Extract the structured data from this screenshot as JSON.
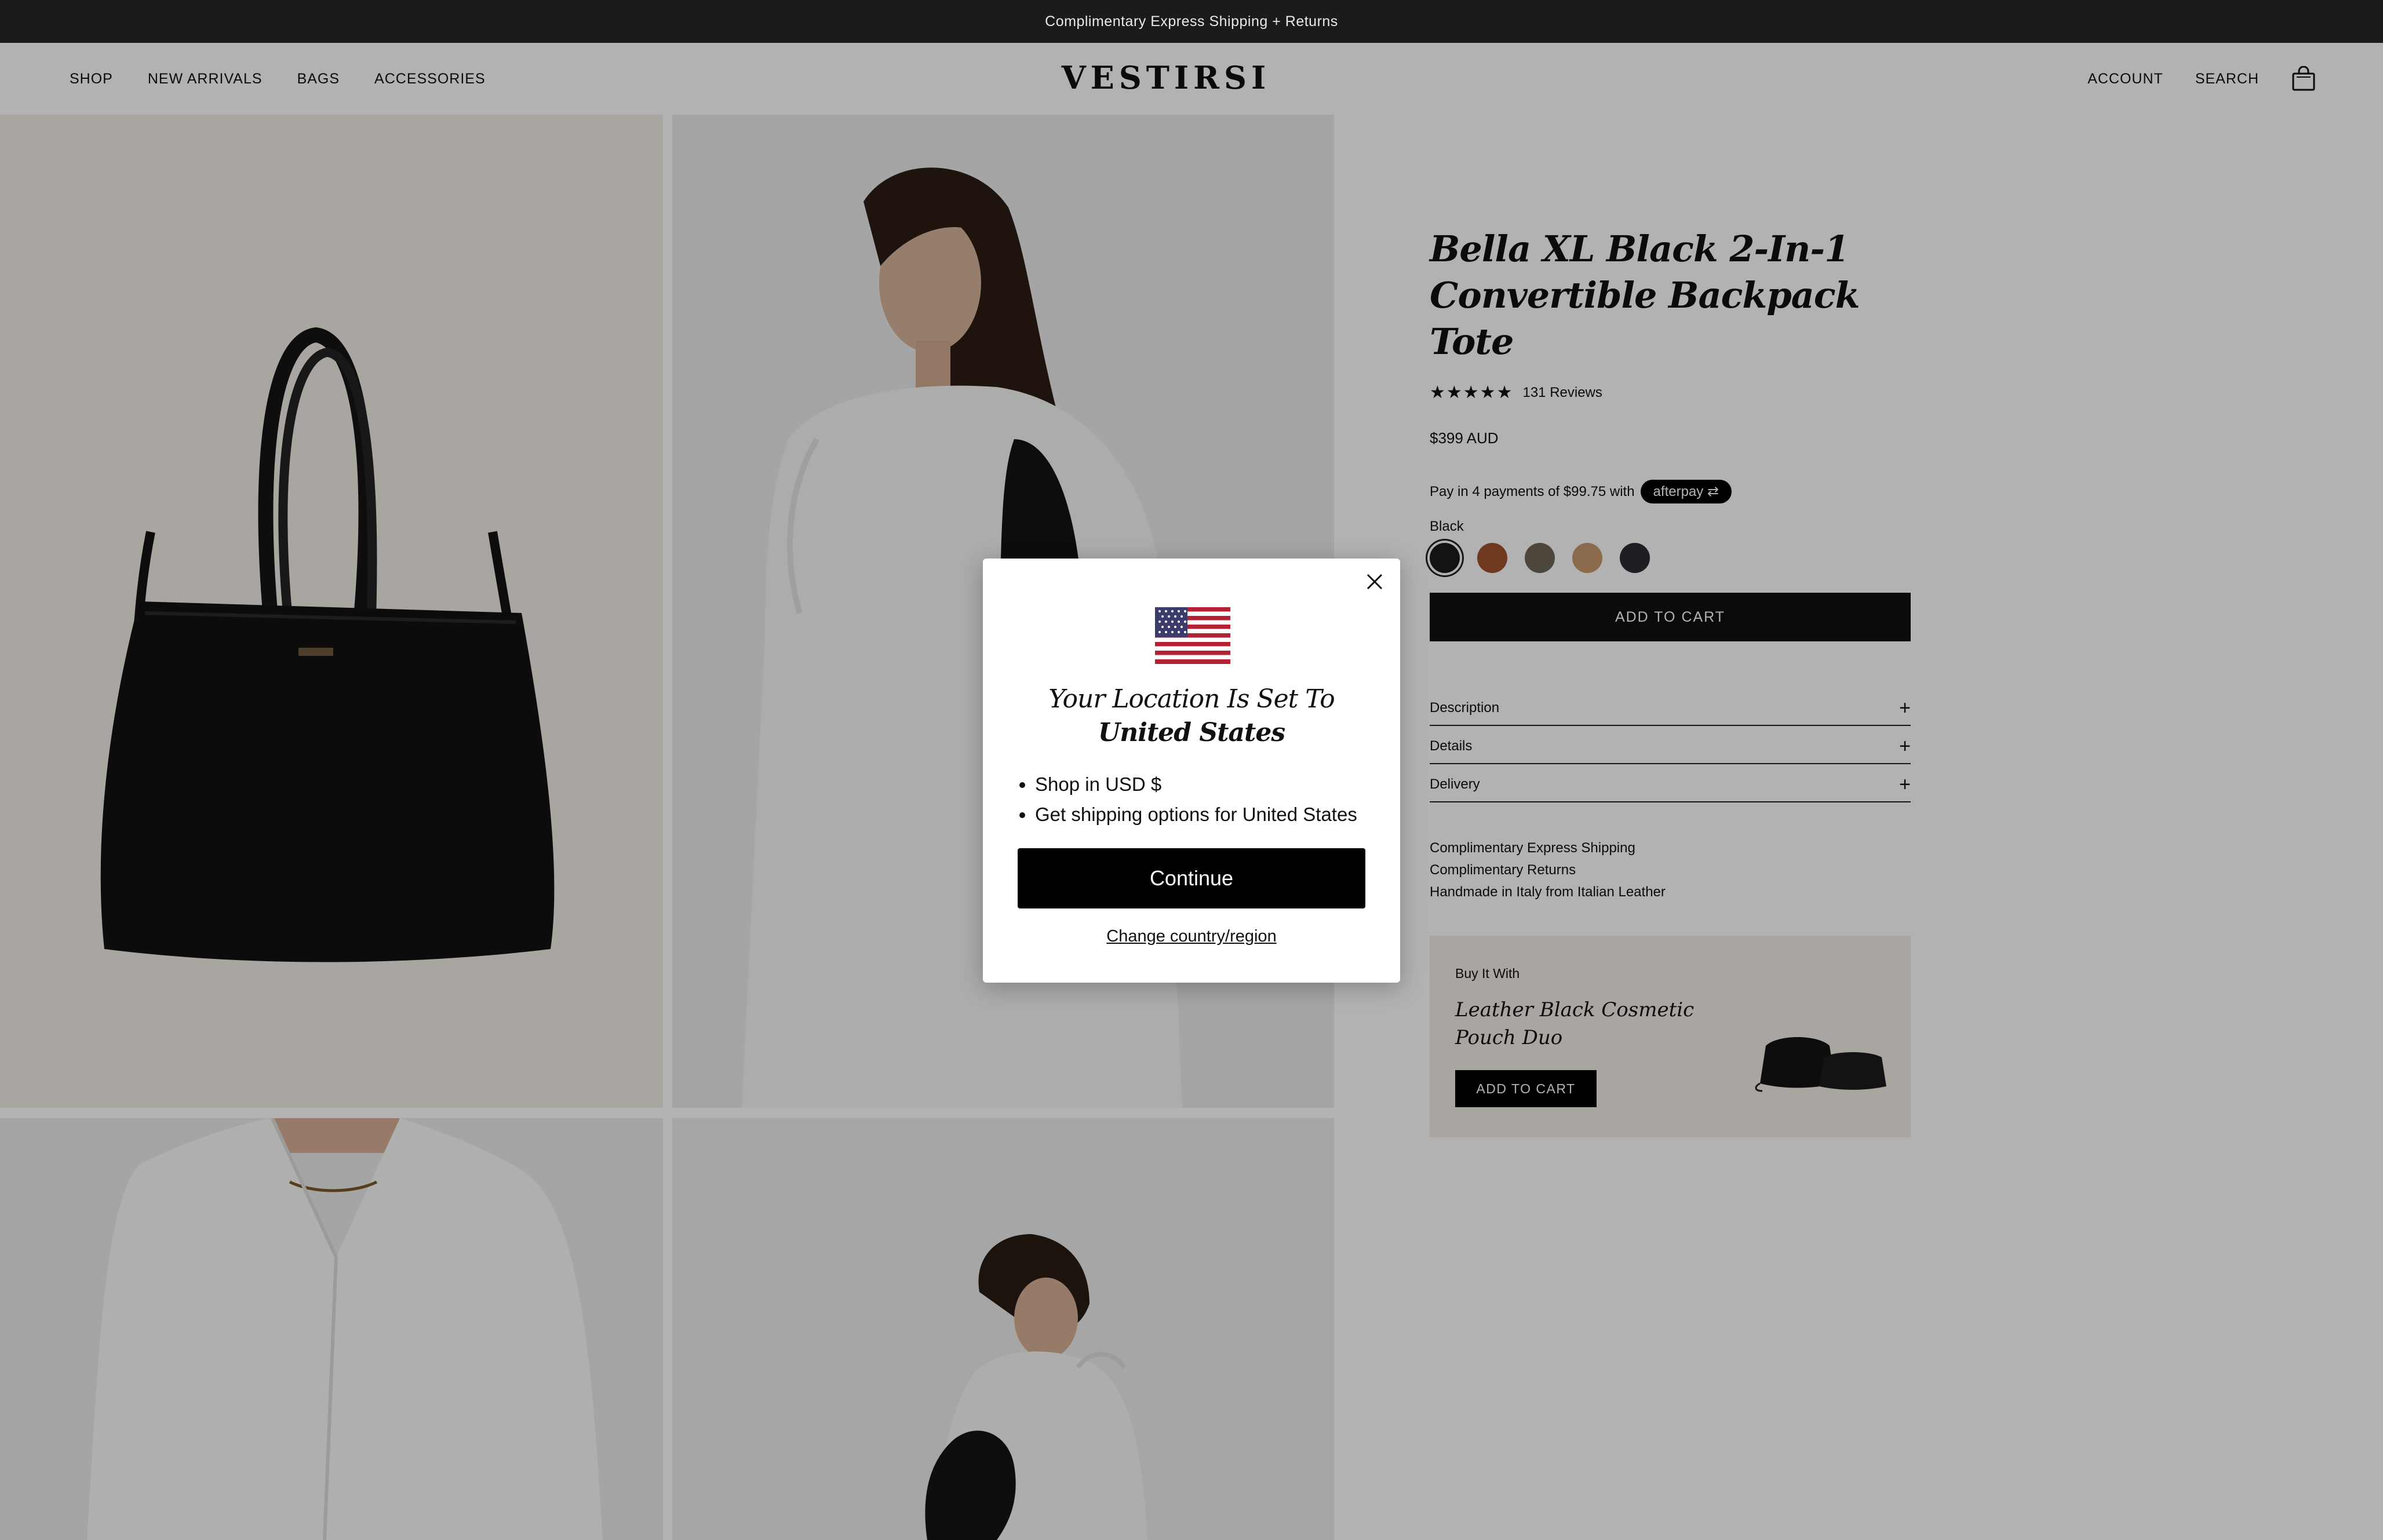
{
  "announcement": "Complimentary Express Shipping + Returns",
  "nav": {
    "left": [
      "SHOP",
      "NEW ARRIVALS",
      "BAGS",
      "ACCESSORIES"
    ],
    "logo": "VESTIRSI",
    "account": "ACCOUNT",
    "search": "SEARCH",
    "cart_icon": "shopping-bag-icon"
  },
  "product": {
    "title": "Bella XL Black 2-In-1 Convertible Backpack Tote",
    "stars": "★★★★★",
    "reviews": "131 Reviews",
    "price": "$399 AUD",
    "afterpay_text": "Pay in 4 payments of $99.75 with",
    "afterpay_badge": "afterpay",
    "color_label": "Black",
    "swatches": [
      {
        "name": "Black",
        "color": "#1c1c1c",
        "selected": true
      },
      {
        "name": "Tan",
        "color": "#a0522d",
        "selected": false
      },
      {
        "name": "Taupe",
        "color": "#6f6557",
        "selected": false
      },
      {
        "name": "Camel",
        "color": "#c79a6c",
        "selected": false
      },
      {
        "name": "Navy",
        "color": "#2a2d36",
        "selected": false
      }
    ],
    "add_to_cart": "ADD TO CART",
    "accordion": [
      "Description",
      "Details",
      "Delivery"
    ],
    "perks": [
      "Complimentary Express Shipping",
      "Complimentary Returns",
      "Handmade in Italy from Italian Leather"
    ]
  },
  "upsell": {
    "kicker": "Buy It With",
    "title": "Leather Black Cosmetic Pouch Duo",
    "button": "ADD TO CART"
  },
  "modal": {
    "title_prefix": "Your Location Is Set To ",
    "title_country": "United States",
    "bullets": [
      "Shop in USD $",
      "Get shipping options for United States"
    ],
    "continue": "Continue",
    "change": "Change country/region"
  },
  "colors": {
    "overlay": "rgba(0,0,0,0.30)",
    "announce_bg": "#1b1b1b",
    "button_bg": "#111111"
  }
}
